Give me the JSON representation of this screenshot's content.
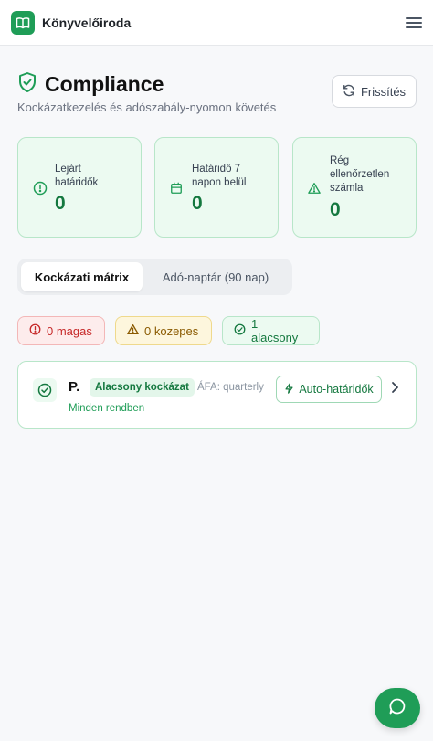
{
  "app": {
    "brand": "Könyvelőiroda",
    "logo_icon": "book-open-icon",
    "menu_icon": "hamburger-menu-icon"
  },
  "page": {
    "title": "Compliance",
    "title_icon": "shield-check-icon",
    "subtitle": "Kockázatkezelés és adószabály-nyomon követés",
    "refresh_label": "Frissítés"
  },
  "stats": [
    {
      "label_lines": [
        "Lejárt",
        "határidők"
      ],
      "value": "0",
      "icon": "alert-circle-icon"
    },
    {
      "label_lines": [
        "Határidő 7",
        "napon belül"
      ],
      "value": "0",
      "icon": "calendar-icon"
    },
    {
      "label_lines": [
        "Rég",
        "ellenőrzetlen",
        "számla"
      ],
      "value": "0",
      "icon": "alert-triangle-icon"
    }
  ],
  "tabs": [
    {
      "label": "Kockázati mátrix",
      "active": true
    },
    {
      "label": "Adó-naptár (90 nap)",
      "active": false
    }
  ],
  "risk_filters": [
    {
      "label": "0 magas",
      "icon": "alert-circle-icon",
      "color": "#c62828"
    },
    {
      "label": "0 kozepes",
      "icon": "alert-triangle-icon",
      "color": "#8a5a00"
    },
    {
      "label": "1 alacsony",
      "icon": "check-circle-icon",
      "color": "#14783f"
    }
  ],
  "clients": [
    {
      "name": "P.",
      "risk_tag": "Alacsony kockázat",
      "vat": "ÁFA: quarterly",
      "status": "Minden rendben",
      "action_label": "Auto-határidők"
    }
  ],
  "colors": {
    "accent": "#1f9d57",
    "accent_dark": "#14783f",
    "high": "#c62828",
    "medium": "#8a5a00"
  },
  "chat_icon": "chat-bubble-icon"
}
